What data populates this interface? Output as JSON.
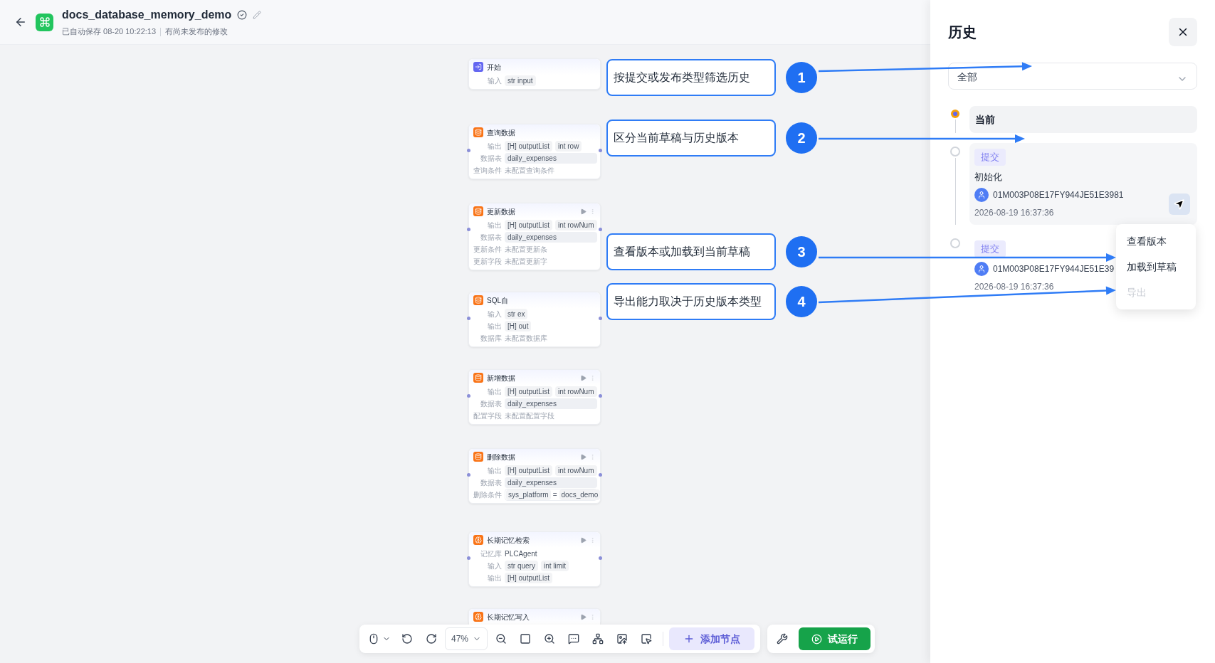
{
  "header": {
    "title": "docs_database_memory_demo",
    "saved": "已自动保存 08-20 10:22:13",
    "status": "有尚未发布的修改"
  },
  "nodes": [
    {
      "title": "开始",
      "kind": "start",
      "color": "#6366f1",
      "run_button": false,
      "rows": [
        {
          "label": "输入",
          "kind": "tags",
          "tags": [
            "str input"
          ]
        }
      ]
    },
    {
      "title": "查询数据",
      "kind": "data",
      "color": "#f97316",
      "run_button": false,
      "rows": [
        {
          "label": "输出",
          "kind": "tags",
          "tags": [
            "[H] outputList",
            "int row"
          ]
        },
        {
          "label": "数据表",
          "kind": "field",
          "value": "daily_expenses"
        },
        {
          "label": "查询条件",
          "kind": "empty",
          "placeholder": "未配置查询条件"
        }
      ]
    },
    {
      "title": "更新数据",
      "kind": "data",
      "color": "#f97316",
      "run_button": true,
      "rows": [
        {
          "label": "输出",
          "kind": "tags",
          "tags": [
            "[H] outputList",
            "int rowNum"
          ]
        },
        {
          "label": "数据表",
          "kind": "field",
          "value": "daily_expenses"
        },
        {
          "label": "更新条件",
          "kind": "empty",
          "placeholder": "未配置更新条"
        },
        {
          "label": "更新字段",
          "kind": "empty",
          "placeholder": "未配置更新字"
        }
      ]
    },
    {
      "title": "SQL自",
      "kind": "data",
      "color": "#f97316",
      "run_button": false,
      "rows": [
        {
          "label": "输入",
          "kind": "tags",
          "tags": [
            "str ex"
          ]
        },
        {
          "label": "输出",
          "kind": "tags",
          "tags": [
            "[H] out"
          ]
        },
        {
          "label": "数据库",
          "kind": "empty",
          "placeholder": "未配置数据库"
        }
      ]
    },
    {
      "title": "新增数据",
      "kind": "data",
      "color": "#f97316",
      "run_button": true,
      "rows": [
        {
          "label": "输出",
          "kind": "tags",
          "tags": [
            "[H] outputList",
            "int rowNum"
          ]
        },
        {
          "label": "数据表",
          "kind": "field",
          "value": "daily_expenses"
        },
        {
          "label": "配置字段",
          "kind": "empty",
          "placeholder": "未配置配置字段"
        }
      ]
    },
    {
      "title": "删除数据",
      "kind": "data",
      "color": "#f97316",
      "run_button": true,
      "rows": [
        {
          "label": "输出",
          "kind": "tags",
          "tags": [
            "[H] outputList",
            "int rowNum"
          ]
        },
        {
          "label": "数据表",
          "kind": "field",
          "value": "daily_expenses"
        },
        {
          "label": "删除条件",
          "kind": "condition",
          "left": "sys_platform",
          "op": "=",
          "right": "docs_demo"
        }
      ]
    },
    {
      "title": "长期记忆检索",
      "kind": "memory",
      "color": "#f97316",
      "run_button": true,
      "rows": [
        {
          "label": "记忆库",
          "kind": "text",
          "value": "PLCAgent"
        },
        {
          "label": "输入",
          "kind": "tags",
          "tags": [
            "str query",
            "int limit"
          ]
        },
        {
          "label": "输出",
          "kind": "tags",
          "tags": [
            "[H] outputList"
          ]
        }
      ]
    },
    {
      "title": "长期记忆写入",
      "kind": "memory",
      "color": "#f97316",
      "run_button": true
    }
  ],
  "toolbar": {
    "zoom": "47%",
    "add_node": "添加节点",
    "run": "试运行"
  },
  "annotations": [
    {
      "number": "1",
      "text": "按提交或发布类型筛选历史"
    },
    {
      "number": "2",
      "text": "区分当前草稿与历史版本"
    },
    {
      "number": "3",
      "text": "查看版本或加载到当前草稿"
    },
    {
      "number": "4",
      "text": "导出能力取决于历史版本类型"
    }
  ],
  "history": {
    "title": "历史",
    "filter": "全部",
    "items": [
      {
        "kind": "current",
        "label": "当前",
        "selected": true
      },
      {
        "kind": "version",
        "tag": "提交",
        "title": "初始化",
        "author": "01M003P08E17FY944JE51E3981",
        "time": "2026-08-19 16:37:36",
        "selected": false,
        "hovered": true
      },
      {
        "kind": "version",
        "tag": "提交",
        "author": "01M003P08E17FY944JE51E39",
        "time": "2026-08-19 16:37:36",
        "selected": false
      }
    ],
    "menu": [
      {
        "label": "查看版本",
        "disabled": false
      },
      {
        "label": "加载到草稿",
        "disabled": false
      },
      {
        "label": "导出",
        "disabled": true
      }
    ]
  }
}
